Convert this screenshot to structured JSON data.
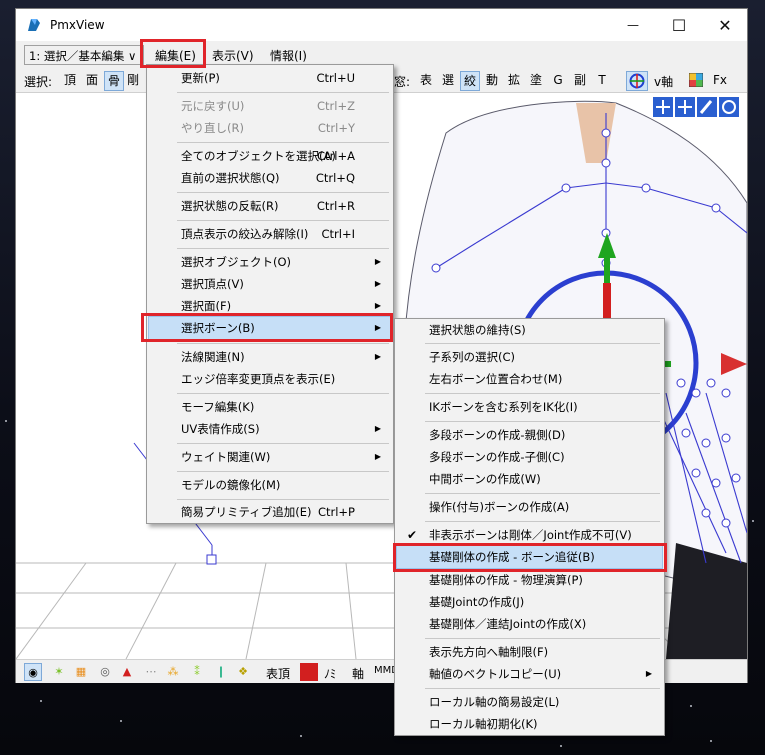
{
  "window": {
    "title": "PmxView",
    "minimize": "—",
    "maximize": "☐",
    "close": "✕"
  },
  "menubar": {
    "mode_select": "1: 選択／基本編集 ∨",
    "menus": [
      "編集(E)",
      "表示(V)",
      "情報(I)"
    ]
  },
  "toolbar": {
    "select_label": "選択:",
    "items": [
      "頂",
      "面",
      "骨",
      "剛"
    ],
    "window_label": "窓:",
    "right_items": [
      "表",
      "選",
      "絞",
      "動",
      "拡",
      "塗",
      "G",
      "副",
      "T"
    ],
    "vaxis": "v軸",
    "fx": "Fx"
  },
  "edit_menu": {
    "items": [
      {
        "label": "更新(P)",
        "shortcut": "Ctrl+U"
      },
      {
        "label": "元に戻す(U)",
        "shortcut": "Ctrl+Z",
        "disabled": true
      },
      {
        "label": "やり直し(R)",
        "shortcut": "Ctrl+Y",
        "disabled": true
      },
      {
        "label": "全てのオブジェクトを選択(A)",
        "shortcut": "Ctrl+A"
      },
      {
        "label": "直前の選択状態(Q)",
        "shortcut": "Ctrl+Q"
      },
      {
        "label": "選択状態の反転(R)",
        "shortcut": "Ctrl+R"
      },
      {
        "label": "頂点表示の絞込み解除(I)",
        "shortcut": "Ctrl+I"
      },
      {
        "label": "選択オブジェクト(O)"
      },
      {
        "label": "選択頂点(V)"
      },
      {
        "label": "選択面(F)"
      },
      {
        "label": "選択ボーン(B)"
      },
      {
        "label": "法線関連(N)"
      },
      {
        "label": "エッジ倍率変更頂点を表示(E)"
      },
      {
        "label": "モーフ編集(K)"
      },
      {
        "label": "UV表情作成(S)"
      },
      {
        "label": "ウェイト関連(W)"
      },
      {
        "label": "モデルの鏡像化(M)"
      },
      {
        "label": "簡易プリミティブ追加(E)",
        "shortcut": "Ctrl+P"
      }
    ]
  },
  "bone_submenu": {
    "items": [
      {
        "label": "選択状態の維持(S)"
      },
      {
        "label": "子系列の選択(C)"
      },
      {
        "label": "左右ボーン位置合わせ(M)"
      },
      {
        "label": "IKボーンを含む系列をIK化(I)"
      },
      {
        "label": "多段ボーンの作成-親側(D)"
      },
      {
        "label": "多段ボーンの作成-子側(C)"
      },
      {
        "label": "中間ボーンの作成(W)"
      },
      {
        "label": "操作(付与)ボーンの作成(A)"
      },
      {
        "label": "非表示ボーンは剛体／Joint作成不可(V)",
        "checked": true
      },
      {
        "label": "基礎剛体の作成 - ボーン追従(B)"
      },
      {
        "label": "基礎剛体の作成 - 物理演算(P)"
      },
      {
        "label": "基礎Jointの作成(J)"
      },
      {
        "label": "基礎剛体／連結Jointの作成(X)"
      },
      {
        "label": "表示先方向へ軸制限(F)"
      },
      {
        "label": "軸値のベクトルコピー(U)"
      },
      {
        "label": "ローカル軸の簡易設定(L)"
      },
      {
        "label": "ローカル軸初期化(K)"
      }
    ]
  },
  "statusbar": {
    "items": [
      "表頂",
      "ﾉﾐ",
      "軸",
      "MMD"
    ]
  },
  "colors": {
    "highlight": "#c6dff7",
    "callout": "#e0242a",
    "bone": "#3a3ad0"
  }
}
